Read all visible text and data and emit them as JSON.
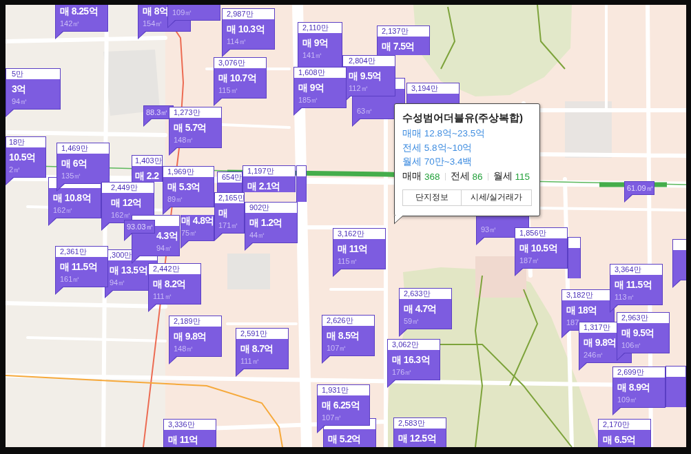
{
  "markers": [
    {
      "kind": "price",
      "price": "매 8.25억",
      "area": "142㎡"
    },
    {
      "kind": "price",
      "price": "매 8억",
      "area": "154㎡"
    },
    {
      "kind": "price",
      "area": "109㎡"
    },
    {
      "kind": "price",
      "unit_price": "2,987만",
      "price": "매 10.3억",
      "area": "114㎡"
    },
    {
      "kind": "price",
      "unit_price": "2,110만",
      "price": "매 9억",
      "area": "141㎡"
    },
    {
      "kind": "price",
      "unit_price": "2,137만",
      "price": "매 7.5억"
    },
    {
      "kind": "price",
      "unit_price": "3,076만",
      "price": "매 10.7억",
      "area": "115㎡"
    },
    {
      "kind": "price",
      "unit_price": "2,804만",
      "price": "매 9.5억",
      "area": "112㎡"
    },
    {
      "kind": "price",
      "unit_price": "5만",
      "price": "3억",
      "area": "94㎡"
    },
    {
      "kind": "price",
      "unit_price": "1,608만",
      "price": "매 9억",
      "area": "185㎡"
    },
    {
      "kind": "price",
      "area": "63㎡"
    },
    {
      "kind": "price",
      "unit_price": "3,194만"
    },
    {
      "kind": "area_tag",
      "area": "88.3㎡"
    },
    {
      "kind": "price",
      "unit_price": "1,273만",
      "price": "매 5.7억",
      "area": "148㎡"
    },
    {
      "kind": "price",
      "unit_price": "18만",
      "price": "10.5억",
      "area": "2㎡"
    },
    {
      "kind": "price",
      "unit_price": "1,469만",
      "price": "매 6억",
      "area": "135㎡"
    },
    {
      "kind": "price",
      "unit_price": "1,403만",
      "price": "매 2.2"
    },
    {
      "kind": "price",
      "unit_price": "1,969만",
      "price": "매 5.3억",
      "area": "89㎡"
    },
    {
      "kind": "price",
      "unit_price": "654만"
    },
    {
      "kind": "price",
      "unit_price": "1,197만",
      "price": "매 2.1억"
    },
    {
      "kind": "price"
    },
    {
      "kind": "price",
      "price": "매 10.8억",
      "area": "162㎡"
    },
    {
      "kind": "price",
      "unit_price": "2,449만",
      "price": "매 12억",
      "area": "162㎡"
    },
    {
      "kind": "area_tag",
      "area": "61.09㎡"
    },
    {
      "kind": "price",
      "unit_price": "2,165만",
      "price": "매",
      "area": "171㎡"
    },
    {
      "kind": "price",
      "unit_price": "902만",
      "price": "매 1.2억",
      "area": "44㎡"
    },
    {
      "kind": "price",
      "area": "93㎡"
    },
    {
      "kind": "area_tag",
      "area": "93.03㎡"
    },
    {
      "kind": "price",
      "price": "4.3억",
      "area": "94㎡"
    },
    {
      "kind": "price",
      "price": "매 4.8억",
      "area": "75㎡"
    },
    {
      "kind": "price",
      "unit_price": "3,162만",
      "price": "매 11억",
      "area": "115㎡"
    },
    {
      "kind": "price",
      "unit_price": "1,856만",
      "price": "매 10.5억",
      "area": "187㎡"
    },
    {
      "kind": "price"
    },
    {
      "kind": "price"
    },
    {
      "kind": "price",
      "unit_price": "2,361만",
      "price": "매 11.5억",
      "area": "161㎡"
    },
    {
      "kind": "price",
      "unit_price": ",300만",
      "price": "매 13.5억",
      "area": "94㎡"
    },
    {
      "kind": "price",
      "unit_price": "2,442만",
      "price": "매 8.2억",
      "area": "111㎡"
    },
    {
      "kind": "price",
      "unit_price": "3,364만",
      "price": "매 11.5억",
      "area": "113㎡"
    },
    {
      "kind": "price",
      "unit_price": "2,633만",
      "price": "매 4.7억",
      "area": "59㎡"
    },
    {
      "kind": "price",
      "unit_price": "3,182만",
      "price": "매 18억",
      "area": "187"
    },
    {
      "kind": "price",
      "unit_price": "2,189만",
      "price": "매 9.8억",
      "area": "148㎡"
    },
    {
      "kind": "price",
      "unit_price": "2,591만",
      "price": "매 8.7억",
      "area": "111㎡"
    },
    {
      "kind": "price",
      "unit_price": "2,626만",
      "price": "매 8.5억",
      "area": "107㎡"
    },
    {
      "kind": "price",
      "unit_price": "1,317만",
      "price": "매 9.8억",
      "area": "246㎡"
    },
    {
      "kind": "price",
      "unit_price": "2,963만",
      "price": "매 9.5억",
      "area": "106㎡"
    },
    {
      "kind": "price",
      "unit_price": "3,062만",
      "price": "매 16.3억",
      "area": "176㎡"
    },
    {
      "kind": "price",
      "unit_price": "2,699만",
      "price": "매 8.9억",
      "area": "109㎡"
    },
    {
      "kind": "price"
    },
    {
      "kind": "price",
      "unit_price": "1,931만",
      "price": "매 6.25억",
      "area": "107㎡"
    },
    {
      "kind": "price",
      "unit_price": "3,336만",
      "price": "매 11억"
    },
    {
      "kind": "price",
      "price": "매 5.2억"
    },
    {
      "kind": "price",
      "unit_price": "2,583만",
      "price": "매 12.5억"
    },
    {
      "kind": "price",
      "unit_price": "2,170만",
      "price": "매 6.5억"
    }
  ],
  "popup": {
    "title": "수성범어더블유(주상복합)",
    "ranges": [
      "매매 12.8억~23.5억",
      "전세 5.8억~10억",
      "월세 70만~3.4백"
    ],
    "counts": [
      {
        "label": "매매",
        "value": "368"
      },
      {
        "label": "전세",
        "value": "86"
      },
      {
        "label": "월세",
        "value": "115"
      }
    ],
    "buttons": [
      "단지정보",
      "시세/실거래가"
    ]
  }
}
